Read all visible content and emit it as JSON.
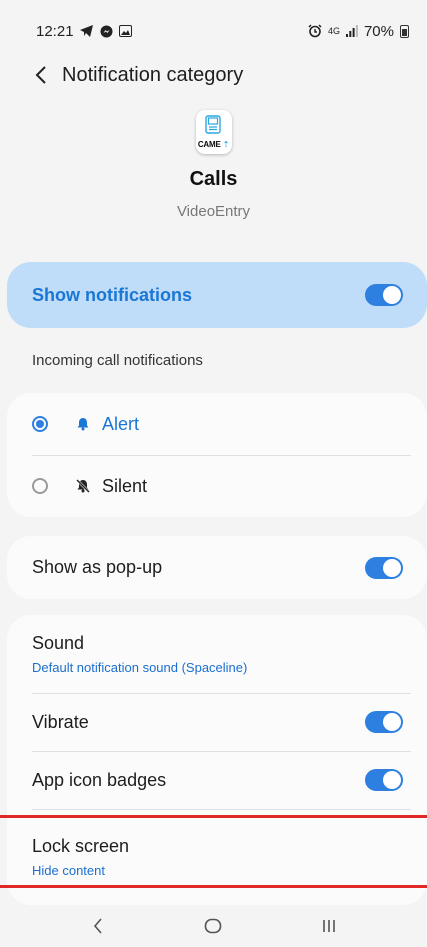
{
  "status_bar": {
    "time": "12:21",
    "network": "4G",
    "battery": "70%"
  },
  "header": {
    "title": "Notification category",
    "back_icon": "chevron-left-icon"
  },
  "app": {
    "logo_text_main": "CAME",
    "channel_name": "Calls",
    "app_name": "VideoEntry"
  },
  "show_notifications": {
    "label": "Show notifications",
    "enabled": true
  },
  "section_label": "Incoming call notifications",
  "alert_options": [
    {
      "label": "Alert",
      "selected": true,
      "icon": "bell-icon"
    },
    {
      "label": "Silent",
      "selected": false,
      "icon": "bell-off-icon"
    }
  ],
  "popup": {
    "label": "Show as pop-up",
    "enabled": true
  },
  "settings": {
    "sound_label": "Sound",
    "sound_value": "Default notification sound (Spaceline)",
    "vibrate_label": "Vibrate",
    "vibrate_enabled": true,
    "badges_label": "App icon badges",
    "badges_enabled": true,
    "lock_label": "Lock screen",
    "lock_value": "Hide content"
  },
  "colors": {
    "accent": "#2d7fe0",
    "highlight_bg": "#bfdcf8",
    "annotation": "#e02828"
  },
  "nav": [
    "back-icon",
    "home-icon",
    "recents-icon"
  ]
}
